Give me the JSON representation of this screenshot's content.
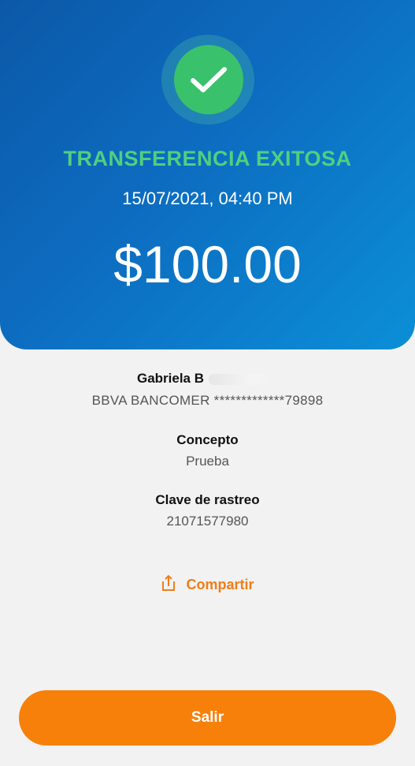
{
  "header": {
    "status_title": "TRANSFERENCIA EXITOSA",
    "datetime": "15/07/2021, 04:40 PM",
    "amount": "$100.00",
    "status_icon": "check-icon",
    "colors": {
      "gradient_start": "#0c58a8",
      "gradient_end": "#0b8fd6",
      "success_green": "#39c26b",
      "status_text": "#4fd07f"
    }
  },
  "recipient": {
    "name": "Gabriela B",
    "bank_account": "BBVA BANCOMER *************79898"
  },
  "details": {
    "concept_label": "Concepto",
    "concept_value": "Prueba",
    "tracking_label": "Clave de rastreo",
    "tracking_value": "21071577980"
  },
  "share": {
    "label": "Compartir",
    "icon": "share-icon",
    "color": "#f07d18"
  },
  "exit_button": {
    "label": "Salir",
    "color": "#f7800a"
  }
}
